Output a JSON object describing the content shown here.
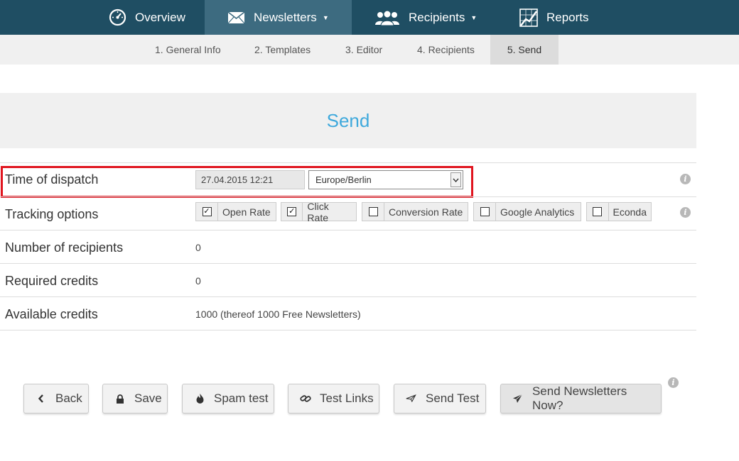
{
  "topnav": {
    "items": [
      {
        "label": "Overview",
        "icon": "dashboard-icon"
      },
      {
        "label": "Newsletters",
        "icon": "envelope-icon",
        "active": true,
        "caret": "▼"
      },
      {
        "label": "Recipients",
        "icon": "users-icon",
        "caret": "▼"
      },
      {
        "label": "Reports",
        "icon": "chart-icon"
      }
    ]
  },
  "steps": [
    {
      "label": "1. General Info"
    },
    {
      "label": "2. Templates"
    },
    {
      "label": "3. Editor"
    },
    {
      "label": "4. Recipients"
    },
    {
      "label": "5. Send",
      "active": true
    }
  ],
  "section": {
    "title": "Send"
  },
  "form": {
    "dispatch": {
      "label": "Time of dispatch",
      "datetime": "27.04.2015 12:21",
      "timezone": "Europe/Berlin"
    },
    "tracking": {
      "label": "Tracking options",
      "options": [
        {
          "label": "Open Rate",
          "checked": true
        },
        {
          "label": "Click Rate",
          "checked": true
        },
        {
          "label": "Conversion Rate",
          "checked": false
        },
        {
          "label": "Google Analytics",
          "checked": false
        },
        {
          "label": "Econda",
          "checked": false
        }
      ]
    },
    "recipients": {
      "label": "Number of recipients",
      "value": "0"
    },
    "required": {
      "label": "Required credits",
      "value": "0"
    },
    "available": {
      "label": "Available credits",
      "value": "1000 (thereof 1000 Free Newsletters)"
    }
  },
  "buttons": {
    "back": "Back",
    "save": "Save",
    "spam": "Spam test",
    "links": "Test Links",
    "send_test": "Send Test",
    "send_now": "Send Newsletters Now?"
  },
  "info_glyph": "i",
  "colors": {
    "topnav_bg": "#1f4e63",
    "topnav_active": "#3d6b80",
    "accent": "#3fa9dc",
    "highlight": "#e0141e"
  }
}
